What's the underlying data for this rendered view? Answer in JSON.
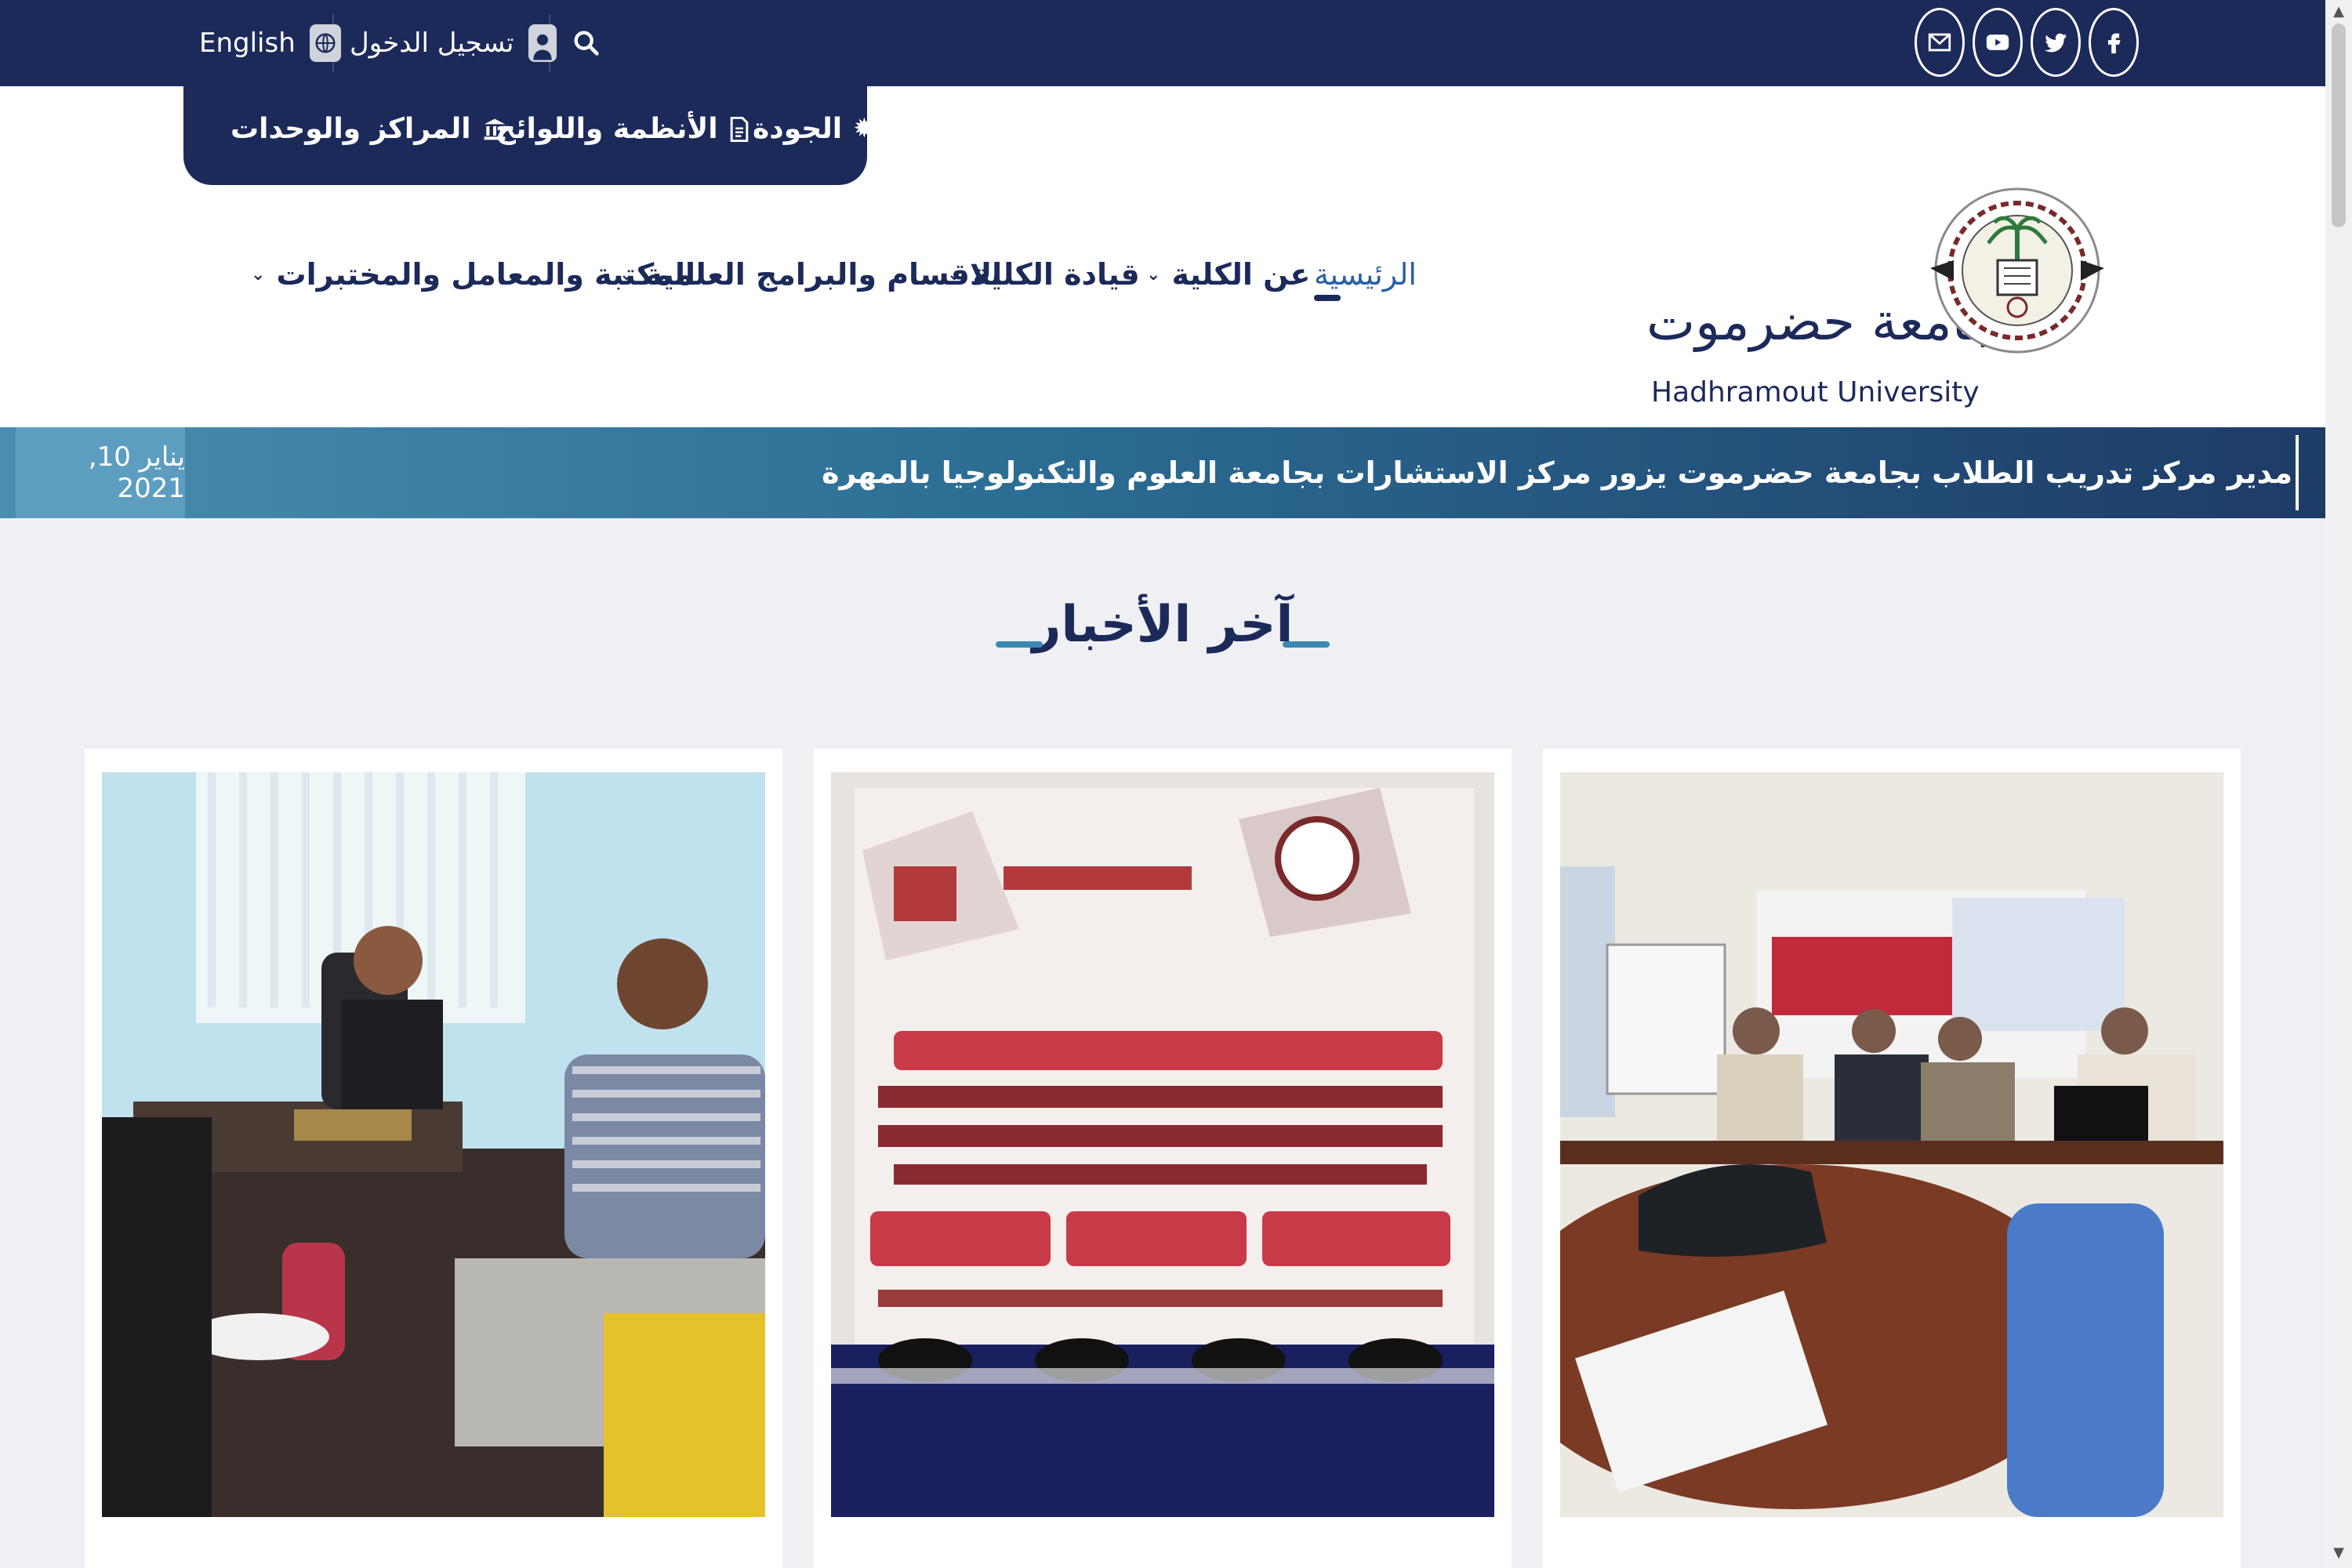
{
  "topbar": {
    "language_label": "English",
    "login_label": "تسجيل الدخول",
    "social": [
      "facebook-icon",
      "twitter-icon",
      "youtube-icon",
      "mail-icon"
    ]
  },
  "tabs": {
    "quality": "الجودة",
    "regulations": "الأنظمة واللوائح",
    "centers": "المراكز والوحدات"
  },
  "nav": {
    "home": "الرئيسية",
    "about": "عن الكلية",
    "leadership": "قيادة الكلية",
    "departments": "الاقسام والبرامج العلمية",
    "library": "المكتبة والمعامل والمختبرات"
  },
  "logo": {
    "name_ar": "جامعة حضرموت",
    "name_en": "Hadhramout University"
  },
  "ticker": {
    "headline": "مدير مركز تدريب الطلاب بجامعة حضرموت يزور مركز الاستشارات بجامعة العلوم والتكنولوجيا بالمهرة",
    "date": "يناير 10, 2021"
  },
  "section": {
    "title": "آخر الأخبار"
  },
  "colors": {
    "navy": "#1c2a5a",
    "accent": "#3b88b3",
    "background": "#eef0f3"
  }
}
